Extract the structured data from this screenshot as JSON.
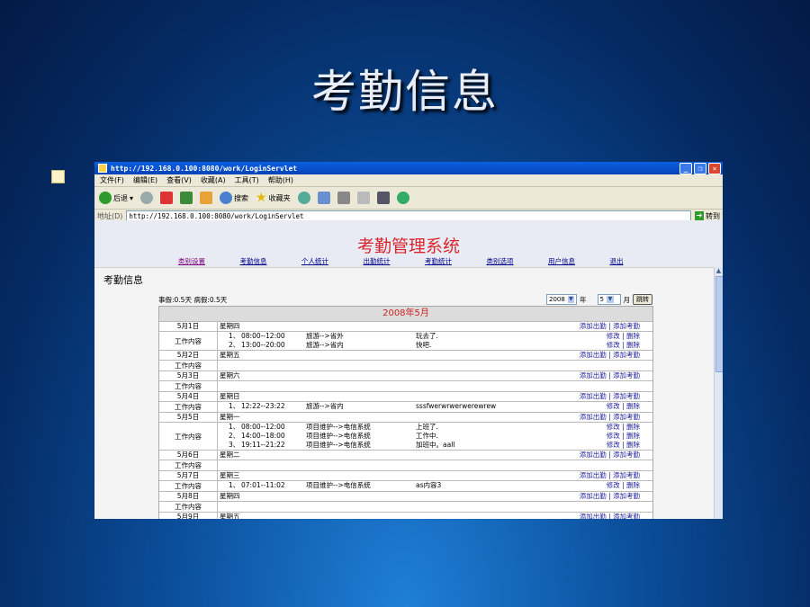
{
  "slide": {
    "title": "考勤信息"
  },
  "browser": {
    "title": "http://192.168.0.100:8080/work/LoginServlet",
    "menu": [
      "文件(F)",
      "编辑(E)",
      "查看(V)",
      "收藏(A)",
      "工具(T)",
      "帮助(H)"
    ],
    "toolbar": {
      "back": "后退",
      "search": "搜索",
      "favorites": "收藏夹"
    },
    "address_label": "地址(D)",
    "address": "http://192.168.0.100:8080/work/LoginServlet",
    "go": "转到"
  },
  "app": {
    "title": "考勤管理系统",
    "nav": [
      "类别设置",
      "考勤信息",
      "个人统计",
      "出勤统计",
      "考勤统计",
      "类别选项",
      "用户信息",
      "退出"
    ],
    "page_heading": "考勤信息",
    "leave_summary": "事假:0.5天  病假:0.5天",
    "year_value": "2008",
    "year_label": "年",
    "month_value": "5",
    "month_label": "月",
    "jump": "跳转",
    "month_title": "2008年5月",
    "add_actions": "添加出勤 | 添加考勤",
    "edit_actions": "修改 | 删除",
    "work_label": "工作内容",
    "days": [
      {
        "date": "5月1日",
        "weekday": "星期四",
        "items": [
          {
            "no": "1、",
            "time": "08:00--12:00",
            "cat": "旅游-->省外",
            "note": "玩去了."
          },
          {
            "no": "2、",
            "time": "13:00--20:00",
            "cat": "旅游-->省内",
            "note": "快吧."
          }
        ]
      },
      {
        "date": "5月2日",
        "weekday": "星期五",
        "items": []
      },
      {
        "date": "5月3日",
        "weekday": "星期六",
        "items": []
      },
      {
        "date": "5月4日",
        "weekday": "星期日",
        "items": [
          {
            "no": "1、",
            "time": "12:22--23:22",
            "cat": "旅游-->省内",
            "note": "sssfwerwrwerwerewrew"
          }
        ]
      },
      {
        "date": "5月5日",
        "weekday": "星期一",
        "items": [
          {
            "no": "1、",
            "time": "08:00--12:00",
            "cat": "项目维护-->电信系统",
            "note": "上班了."
          },
          {
            "no": "2、",
            "time": "14:00--18:00",
            "cat": "项目维护-->电信系统",
            "note": "工作中."
          },
          {
            "no": "3、",
            "time": "19:11--21:22",
            "cat": "项目维护-->电信系统",
            "note": "加班中。aall"
          }
        ]
      },
      {
        "date": "5月6日",
        "weekday": "星期二",
        "items": []
      },
      {
        "date": "5月7日",
        "weekday": "星期三",
        "items": [
          {
            "no": "1、",
            "time": "07:01--11:02",
            "cat": "项目维护-->电信系统",
            "note": "as内容3"
          }
        ]
      },
      {
        "date": "5月8日",
        "weekday": "星期四",
        "items": []
      },
      {
        "date": "5月9日",
        "weekday": "星期五",
        "items": []
      }
    ]
  }
}
